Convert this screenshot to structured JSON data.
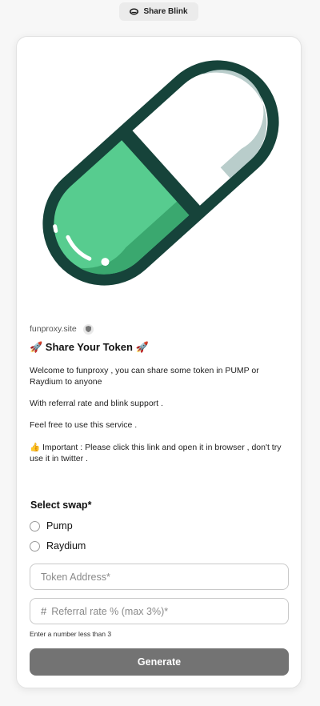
{
  "header": {
    "title": "Share Blink",
    "logo_icon": "blinks-logo-icon"
  },
  "card": {
    "hero_icon": "pill-capsule-icon",
    "hero_colors": {
      "outline": "#16433a",
      "green": "#57cc8f",
      "shade": "#3aa86f",
      "white": "#ffffff",
      "gray_shade": "#b9cdcb"
    },
    "site": "funproxy.site",
    "site_badge_icon": "shield-icon",
    "title_prefix_icon": "rocket-emoji",
    "title_suffix_icon": "rocket-emoji",
    "title": "🚀 Share Your Token 🚀",
    "description": [
      "Welcome to funproxy , you can share some token in PUMP or Raydium to anyone",
      "With referral rate and blink support .",
      "Feel free to use this service .",
      "👍 Important : Please click this link and open it in browser , don't try use it in twitter ."
    ]
  },
  "form": {
    "select_label": "Select swap*",
    "options": [
      "Pump",
      "Raydium"
    ],
    "token_address": {
      "placeholder": "Token Address*",
      "value": ""
    },
    "referral_rate": {
      "placeholder": "Referral rate % (max 3%)*",
      "value": "",
      "prefix": "#"
    },
    "hint": "Enter a number less than 3",
    "submit_label": "Generate",
    "submit_color": "#737373"
  }
}
